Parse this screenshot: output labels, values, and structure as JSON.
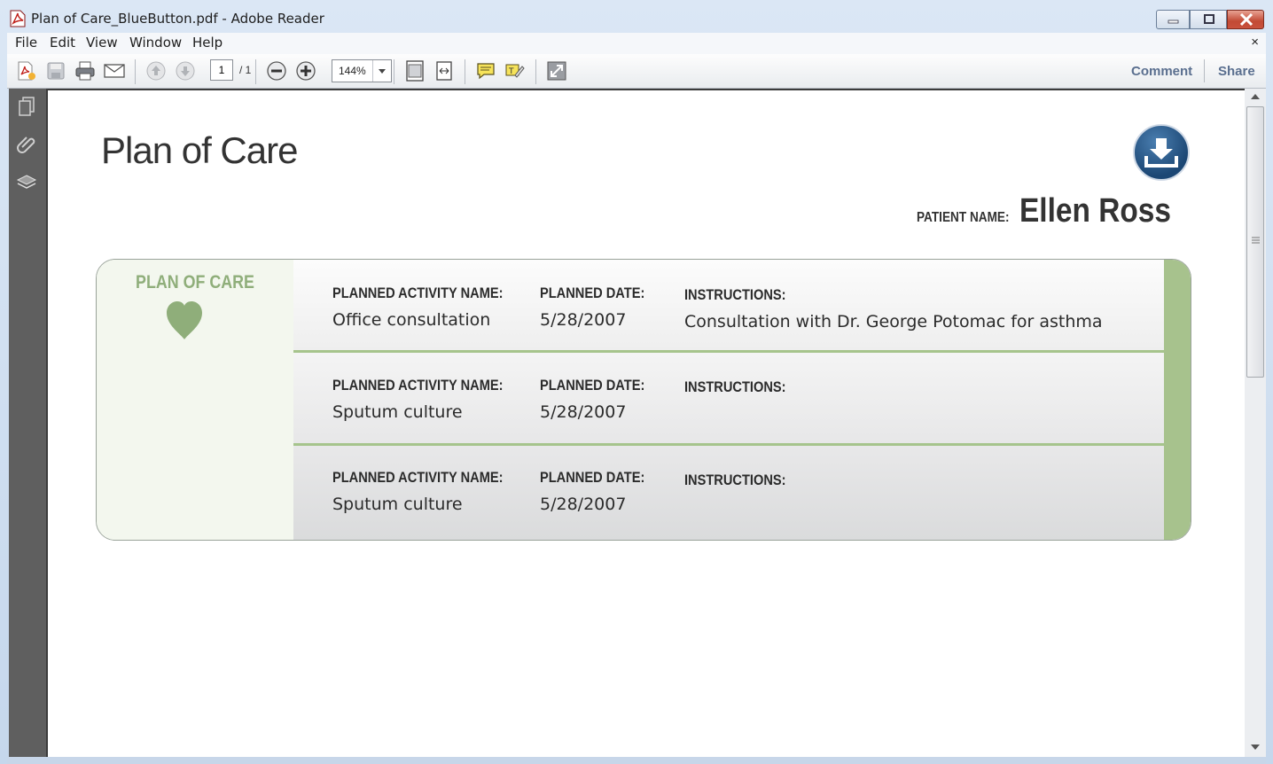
{
  "window": {
    "title": "Plan of Care_BlueButton.pdf - Adobe Reader"
  },
  "menu": {
    "items": [
      "File",
      "Edit",
      "View",
      "Window",
      "Help"
    ],
    "close_doc": "×"
  },
  "toolbar": {
    "page_current": "1",
    "page_total": "/ 1",
    "zoom": "144%",
    "comment_label": "Comment",
    "share_label": "Share"
  },
  "document": {
    "title": "Plan of Care",
    "patient_label": "PATIENT NAME:",
    "patient_name": "Ellen Ross",
    "section_title": "PLAN OF CARE",
    "column_labels": {
      "activity": "PLANNED ACTIVITY NAME:",
      "date": "PLANNED DATE:",
      "instructions": "INSTRUCTIONS:"
    },
    "rows": [
      {
        "activity": "Office consultation",
        "date": "5/28/2007",
        "instructions": "Consultation with Dr. George Potomac for asthma"
      },
      {
        "activity": "Sputum culture",
        "date": "5/28/2007",
        "instructions": ""
      },
      {
        "activity": "Sputum culture",
        "date": "5/28/2007",
        "instructions": ""
      }
    ]
  },
  "colors": {
    "accent_green": "#a7c28d",
    "section_green": "#8fae7a",
    "download_blue": "#1c4774"
  }
}
